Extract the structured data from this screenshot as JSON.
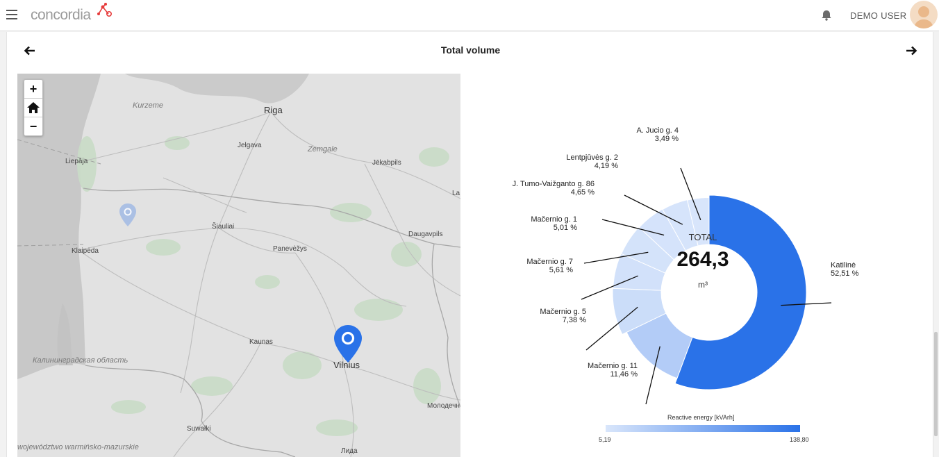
{
  "header": {
    "logo_text": "concordia",
    "user_name": "DEMO USER"
  },
  "panel": {
    "title": "Total volume"
  },
  "map": {
    "controls": {
      "zoom_in": "+",
      "zoom_out": "−"
    },
    "labels": {
      "riga": "Riga",
      "kurzeme": "Kurzeme",
      "zemgale": "Zemgale",
      "jelgava": "Jelgava",
      "liepaja": "Liepāja",
      "jekabpils": "Jēkabpils",
      "siauliai": "Šiauliai",
      "panevezys": "Panevėžys",
      "daugavpils": "Daugavpils",
      "klaipeda": "Klaipėda",
      "kaunas": "Kaunas",
      "vilnius": "Vilnius",
      "kaliningrad": "Калининградская область",
      "suwalki": "Suwałki",
      "warminsko": "województwo warmińsko-mazurskie",
      "lida": "Лида",
      "molodechno": "Молодечн",
      "la": "La"
    }
  },
  "chart_data": {
    "type": "pie",
    "title": "",
    "center": {
      "caption": "TOTAL",
      "value": "264,3",
      "unit": "m³"
    },
    "slices": [
      {
        "label": "Katilinė",
        "percent": 52.51,
        "percent_text": "52,51 %"
      },
      {
        "label": "Mačernio g. 11",
        "percent": 11.46,
        "percent_text": "11,46 %"
      },
      {
        "label": "Mačernio g. 5",
        "percent": 7.38,
        "percent_text": "7,38 %"
      },
      {
        "label": "Mačernio g. 7",
        "percent": 5.61,
        "percent_text": "5,61 %"
      },
      {
        "label": "Mačernio g. 1",
        "percent": 5.01,
        "percent_text": "5,01 %"
      },
      {
        "label": "J. Tumo-Vaižganto g. 86",
        "percent": 4.65,
        "percent_text": "4,65 %"
      },
      {
        "label": "Lentpjūvės g. 2",
        "percent": 4.19,
        "percent_text": "4,19 %"
      },
      {
        "label": "A. Jucio g. 4",
        "percent": 3.49,
        "percent_text": "3,49 %"
      }
    ],
    "color_scale": {
      "title": "Reactive energy [kVArh]",
      "min": "5,19",
      "max": "138,80",
      "min_color": "#d9e6fb",
      "max_color": "#2a72e8"
    }
  }
}
